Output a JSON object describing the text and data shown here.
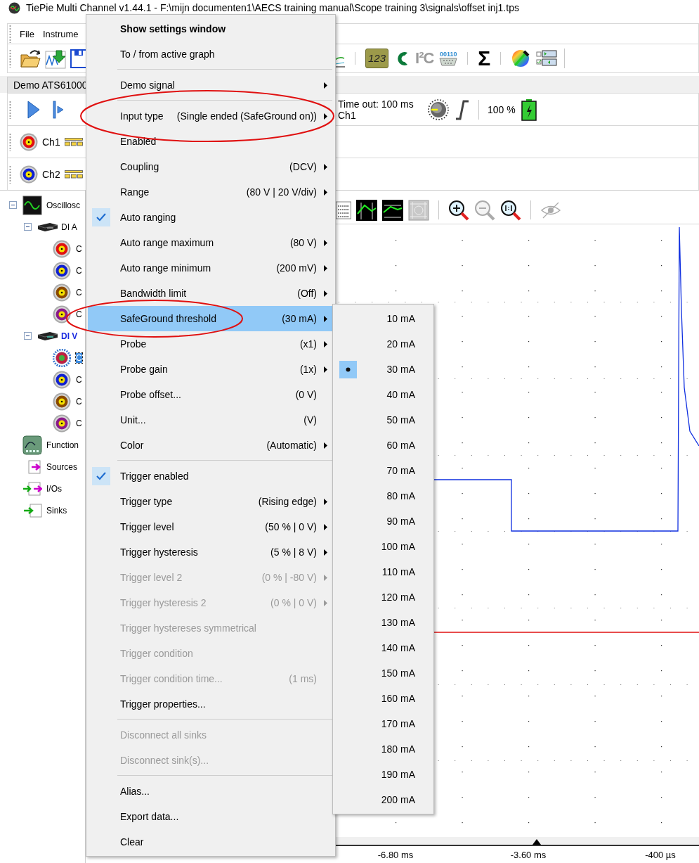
{
  "title_bar": {
    "title": "TiePie Multi Channel v1.44.1 - F:\\mijn documenten1\\AECS training manual\\Scope training 3\\signals\\offset inj1.tps"
  },
  "menu_bar": {
    "items": [
      "File",
      "Instrume"
    ]
  },
  "main_toolbar": {
    "tools": [
      {
        "kind": "chart"
      },
      {
        "kind": "separator"
      },
      {
        "kind": "meter",
        "text": "123"
      },
      {
        "kind": "can"
      },
      {
        "kind": "i2c",
        "text": "I²C"
      },
      {
        "kind": "serial",
        "text": "00110"
      },
      {
        "kind": "separator"
      },
      {
        "kind": "math",
        "text": "Σ"
      },
      {
        "kind": "separator"
      },
      {
        "kind": "color"
      },
      {
        "kind": "layout"
      }
    ]
  },
  "device_tab": {
    "label": "Demo ATS61000"
  },
  "trigger_bar": {
    "timeout": "Time out: 100 ms",
    "source": "Ch1",
    "battery_reading": "100 %"
  },
  "channels": [
    {
      "label": "Ch1",
      "color": "#e01010"
    },
    {
      "label": "Ch2",
      "color": "#1020d0"
    }
  ],
  "tree": [
    {
      "kind": "oscilloscope",
      "label": "Oscillosc",
      "expanded": true,
      "selected": false,
      "children": [
        {
          "kind": "device",
          "label": "DI A",
          "active": false,
          "expanded": true,
          "selected": false,
          "children": [
            {
              "kind": "channel",
              "label": "C",
              "color": "#e01010",
              "selected": false
            },
            {
              "kind": "channel",
              "label": "C",
              "color": "#1020d0",
              "selected": false
            },
            {
              "kind": "channel",
              "label": "C",
              "color": "#8a4a00",
              "selected": false
            },
            {
              "kind": "channel",
              "label": "C",
              "color": "#8a1a8a",
              "selected": false
            }
          ]
        },
        {
          "kind": "device",
          "label": "DI V",
          "active": true,
          "expanded": true,
          "selected": false,
          "children": [
            {
              "kind": "channel",
              "label": "C",
              "color": "#c02040",
              "selected": true
            },
            {
              "kind": "channel",
              "label": "C",
              "color": "#1020d0",
              "selected": false
            },
            {
              "kind": "channel",
              "label": "C",
              "color": "#8a4a00",
              "selected": false
            },
            {
              "kind": "channel",
              "label": "C",
              "color": "#8a1a8a",
              "selected": false
            }
          ]
        }
      ]
    },
    {
      "kind": "generator",
      "label": "Function",
      "selected": false
    },
    {
      "kind": "sources",
      "label": "Sources",
      "selected": false
    },
    {
      "kind": "ios",
      "label": "I/Os",
      "selected": false
    },
    {
      "kind": "sinks",
      "label": "Sinks",
      "selected": false
    }
  ],
  "graph": {
    "tools": [
      {
        "kind": "table",
        "disabled": false
      },
      {
        "kind": "scope_a",
        "disabled": false
      },
      {
        "kind": "scope_b",
        "disabled": false
      },
      {
        "kind": "fit",
        "disabled": true
      },
      {
        "kind": "separator"
      },
      {
        "kind": "zoom_in",
        "disabled": false
      },
      {
        "kind": "zoom_out",
        "disabled": true
      },
      {
        "kind": "zoom_reset",
        "disabled": false
      },
      {
        "kind": "separator"
      },
      {
        "kind": "eye",
        "disabled": true
      }
    ],
    "x_labels": [
      "-6.80 ms",
      "-3.60 ms",
      "-400 µs"
    ]
  },
  "context_menu": {
    "items": [
      {
        "kind": "default",
        "label": "Show settings window",
        "submenu": false,
        "checked": false,
        "disabled": false,
        "selected": false
      },
      {
        "kind": "item",
        "label": "To / from active graph",
        "submenu": false,
        "checked": false,
        "disabled": false,
        "selected": false
      },
      {
        "kind": "separator"
      },
      {
        "kind": "item",
        "label": "Demo signal",
        "submenu": true,
        "checked": false,
        "disabled": false,
        "selected": false
      },
      {
        "kind": "separator"
      },
      {
        "kind": "item",
        "label": "Input type",
        "value": "(Single ended (SafeGround on))",
        "submenu": true,
        "checked": false,
        "disabled": false,
        "selected": false
      },
      {
        "kind": "item",
        "label": "Enabled",
        "submenu": false,
        "checked": false,
        "disabled": false,
        "selected": false
      },
      {
        "kind": "item",
        "label": "Coupling",
        "value": "(DCV)",
        "submenu": true,
        "checked": false,
        "disabled": false,
        "selected": false
      },
      {
        "kind": "item",
        "label": "Range",
        "value": "(80 V | 20 V/div)",
        "submenu": true,
        "checked": false,
        "disabled": false,
        "selected": false
      },
      {
        "kind": "item",
        "label": "Auto ranging",
        "submenu": false,
        "checked": true,
        "disabled": false,
        "selected": false
      },
      {
        "kind": "item",
        "label": "Auto range maximum",
        "value": "(80 V)",
        "submenu": true,
        "checked": false,
        "disabled": false,
        "selected": false
      },
      {
        "kind": "item",
        "label": "Auto range minimum",
        "value": "(200 mV)",
        "submenu": true,
        "checked": false,
        "disabled": false,
        "selected": false
      },
      {
        "kind": "item",
        "label": "Bandwidth limit",
        "value": "(Off)",
        "submenu": true,
        "checked": false,
        "disabled": false,
        "selected": false
      },
      {
        "kind": "item",
        "label": "SafeGround threshold",
        "value": "(30 mA)",
        "submenu": true,
        "checked": false,
        "disabled": false,
        "selected": true
      },
      {
        "kind": "item",
        "label": "Probe",
        "value": "(x1)",
        "submenu": true,
        "checked": false,
        "disabled": false,
        "selected": false
      },
      {
        "kind": "item",
        "label": "Probe gain",
        "value": "(1x)",
        "submenu": true,
        "checked": false,
        "disabled": false,
        "selected": false
      },
      {
        "kind": "item",
        "label": "Probe offset...",
        "value": "(0 V)",
        "submenu": false,
        "checked": false,
        "disabled": false,
        "selected": false
      },
      {
        "kind": "item",
        "label": "Unit...",
        "value": "(V)",
        "submenu": false,
        "checked": false,
        "disabled": false,
        "selected": false
      },
      {
        "kind": "item",
        "label": "Color",
        "value": "(Automatic)",
        "submenu": true,
        "checked": false,
        "disabled": false,
        "selected": false
      },
      {
        "kind": "separator"
      },
      {
        "kind": "item",
        "label": "Trigger enabled",
        "submenu": false,
        "checked": true,
        "disabled": false,
        "selected": false
      },
      {
        "kind": "item",
        "label": "Trigger type",
        "value": "(Rising edge)",
        "submenu": true,
        "checked": false,
        "disabled": false,
        "selected": false
      },
      {
        "kind": "item",
        "label": "Trigger level",
        "value": "(50 % | 0 V)",
        "submenu": true,
        "checked": false,
        "disabled": false,
        "selected": false
      },
      {
        "kind": "item",
        "label": "Trigger hysteresis",
        "value": "(5 % | 8 V)",
        "submenu": true,
        "checked": false,
        "disabled": false,
        "selected": false
      },
      {
        "kind": "item",
        "label": "Trigger level 2",
        "value": "(0 % | -80 V)",
        "submenu": true,
        "checked": false,
        "disabled": true,
        "selected": false
      },
      {
        "kind": "item",
        "label": "Trigger hysteresis 2",
        "value": "(0 % | 0 V)",
        "submenu": true,
        "checked": false,
        "disabled": true,
        "selected": false
      },
      {
        "kind": "item",
        "label": "Trigger hystereses symmetrical",
        "submenu": false,
        "checked": false,
        "disabled": true,
        "selected": false
      },
      {
        "kind": "item",
        "label": "Trigger condition",
        "submenu": false,
        "checked": false,
        "disabled": true,
        "selected": false
      },
      {
        "kind": "item",
        "label": "Trigger condition time...",
        "value": "(1 ms)",
        "submenu": false,
        "checked": false,
        "disabled": true,
        "selected": false
      },
      {
        "kind": "item",
        "label": "Trigger properties...",
        "submenu": false,
        "checked": false,
        "disabled": false,
        "selected": false
      },
      {
        "kind": "separator"
      },
      {
        "kind": "item",
        "label": "Disconnect all sinks",
        "submenu": false,
        "checked": false,
        "disabled": true,
        "selected": false
      },
      {
        "kind": "item",
        "label": "Disconnect sink(s)...",
        "submenu": false,
        "checked": false,
        "disabled": true,
        "selected": false
      },
      {
        "kind": "separator"
      },
      {
        "kind": "item",
        "label": "Alias...",
        "submenu": false,
        "checked": false,
        "disabled": false,
        "selected": false
      },
      {
        "kind": "item",
        "label": "Export data...",
        "submenu": false,
        "checked": false,
        "disabled": false,
        "selected": false
      },
      {
        "kind": "item",
        "label": "Clear",
        "submenu": false,
        "checked": false,
        "disabled": false,
        "selected": false
      }
    ]
  },
  "submenu": {
    "items": [
      {
        "label": "10 mA",
        "selected": false
      },
      {
        "label": "20 mA",
        "selected": false
      },
      {
        "label": "30 mA",
        "selected": true
      },
      {
        "label": "40 mA",
        "selected": false
      },
      {
        "label": "50 mA",
        "selected": false
      },
      {
        "label": "60 mA",
        "selected": false
      },
      {
        "label": "70 mA",
        "selected": false
      },
      {
        "label": "80 mA",
        "selected": false
      },
      {
        "label": "90 mA",
        "selected": false
      },
      {
        "label": "100 mA",
        "selected": false
      },
      {
        "label": "110 mA",
        "selected": false
      },
      {
        "label": "120 mA",
        "selected": false
      },
      {
        "label": "130 mA",
        "selected": false
      },
      {
        "label": "140 mA",
        "selected": false
      },
      {
        "label": "150 mA",
        "selected": false
      },
      {
        "label": "160 mA",
        "selected": false
      },
      {
        "label": "170 mA",
        "selected": false
      },
      {
        "label": "180 mA",
        "selected": false
      },
      {
        "label": "190 mA",
        "selected": false
      },
      {
        "label": "200 mA",
        "selected": false
      }
    ]
  }
}
